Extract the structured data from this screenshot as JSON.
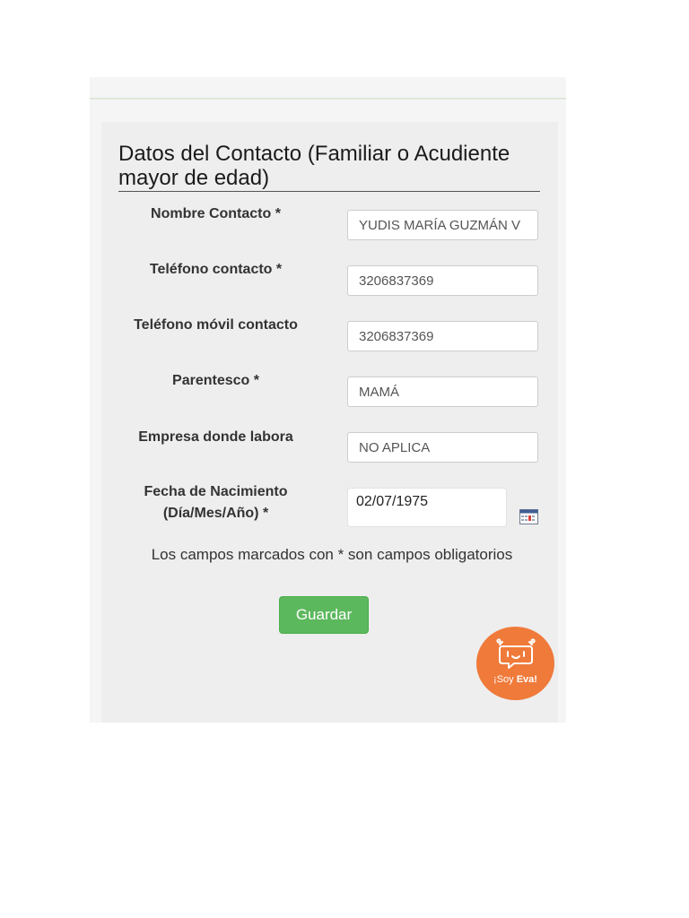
{
  "form": {
    "title": "Datos del Contacto (Familiar o Acudiente mayor de edad)",
    "fields": [
      {
        "label": "Nombre Contacto *",
        "value": "YUDIS MARÍA GUZMÁN V"
      },
      {
        "label": "Teléfono contacto *",
        "value": "3206837369"
      },
      {
        "label": "Teléfono móvil contacto",
        "value": "3206837369"
      },
      {
        "label": "Parentesco *",
        "value": "MAMÁ"
      },
      {
        "label": "Empresa donde labora",
        "value": "NO APLICA"
      }
    ],
    "birthdate": {
      "label_line1": "Fecha de Nacimiento",
      "label_line2": "(Día/Mes/Año) *",
      "value": "02/07/1975",
      "icon": "calendar-icon"
    },
    "required_note": "Los campos marcados con * son campos obligatorios",
    "save_label": "Guardar"
  },
  "assistant": {
    "greeting": "¡Soy ",
    "name": "Eva!",
    "icon": "robot-chat-icon"
  },
  "colors": {
    "button": "#5cb85c",
    "assistant": "#ef7a3a",
    "panel": "#eeeeee"
  }
}
